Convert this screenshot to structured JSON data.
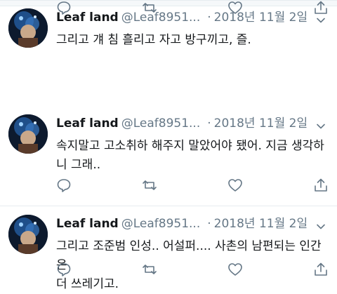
{
  "feed": {
    "tweets": [
      {
        "name": "Leaf land",
        "handle": "@Leaf8951...",
        "separator": "·",
        "time": "2018년 11월 2일",
        "text": "속지말고 고소취하 해주지 말았어야 됐어. 지금 생각하\n니 그래.."
      },
      {
        "name": "Leaf land",
        "handle": "@Leaf8951...",
        "separator": "·",
        "time": "2018년 11월 2일",
        "text": "그리고 조준범 인성.. 어설퍼.... 사촌의 남편되는 인간은\n더 쓰레기고."
      },
      {
        "name": "Leaf land",
        "handle": "@Leaf8951...",
        "separator": "·",
        "time": "2018년 11월 2일",
        "text": "그리고 걔 침 흘리고 자고 방구끼고, 즐."
      }
    ]
  },
  "icons": {
    "reply": "reply-icon",
    "retweet": "retweet-icon",
    "like": "heart-icon",
    "share": "share-icon",
    "more": "chevron-down-icon"
  },
  "colors": {
    "text": "#14171a",
    "secondary": "#657786",
    "divider": "#e6ecf0"
  }
}
